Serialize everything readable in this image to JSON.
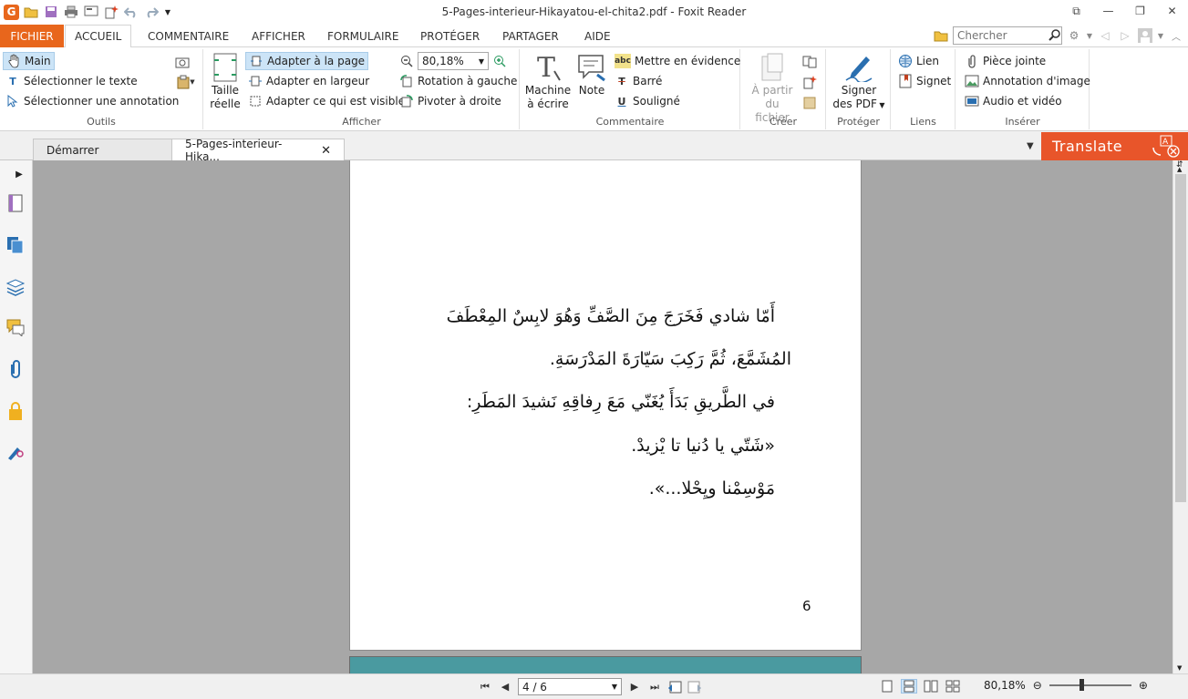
{
  "window": {
    "title": "5-Pages-interieur-Hikayatou-el-chita2.pdf - Foxit Reader",
    "app_icon": "G"
  },
  "ribbon_tabs": [
    "FICHIER",
    "ACCUEIL",
    "COMMENTAIRE",
    "AFFICHER",
    "FORMULAIRE",
    "PROTÉGER",
    "PARTAGER",
    "AIDE"
  ],
  "search": {
    "placeholder": "Chercher"
  },
  "groups": {
    "outils": {
      "label": "Outils",
      "items": [
        "Main",
        "Sélectionner le texte",
        "Sélectionner une annotation"
      ]
    },
    "afficher": {
      "label": "Afficher",
      "big": [
        "Taille",
        "réelle"
      ],
      "items": [
        "Adapter à la page",
        "Adapter en largeur",
        "Adapter ce qui est visible"
      ],
      "zoom_value": "80,18%",
      "rotate_left": "Rotation à gauche",
      "rotate_right": "Pivoter à droite"
    },
    "commentaire": {
      "label": "Commentaire",
      "typewriter": [
        "Machine",
        "à écrire"
      ],
      "note": "Note",
      "highlight": "Mettre en évidence",
      "strike": "Barré",
      "underline": "Souligné"
    },
    "creer": {
      "label": "Créer",
      "from_file": [
        "À partir",
        "du fichier"
      ]
    },
    "proteger": {
      "label": "Protéger",
      "sign": [
        "Signer",
        "des PDF"
      ]
    },
    "liens": {
      "label": "Liens",
      "link": "Lien",
      "bookmark": "Signet"
    },
    "inserer": {
      "label": "Insérer",
      "attachment": "Pièce jointe",
      "image": "Annotation d'image",
      "av": "Audio et vidéo"
    }
  },
  "doc_tabs": [
    {
      "label": "Démarrer"
    },
    {
      "label": "5-Pages-interieur-Hika..."
    }
  ],
  "translate_label": "Translate",
  "page_content": {
    "lines": [
      "أَمّا شادي فَخَرَجَ مِنَ الصَّفِّ وَهُوَ لابِسٌ المِعْطَفَ",
      "المُشَمَّعَ، ثُمَّ رَكِبَ سَيّارَةَ المَدْرَسَةِ.",
      "في الطَّريقِ بَدَأَ يُغَنّي مَعَ رِفاقِهِ نَشيدَ المَطَرِ:",
      "«شَتّي يا دُنيا تا يْزيدْ.",
      "مَوْسِمْنا ويِحْلا...»."
    ],
    "page_number": "6"
  },
  "status": {
    "page_indicator": "4 / 6",
    "zoom": "80,18%"
  },
  "colors": {
    "accent": "#e8661c",
    "translate": "#e8552a",
    "selected": "#cce4f7"
  }
}
